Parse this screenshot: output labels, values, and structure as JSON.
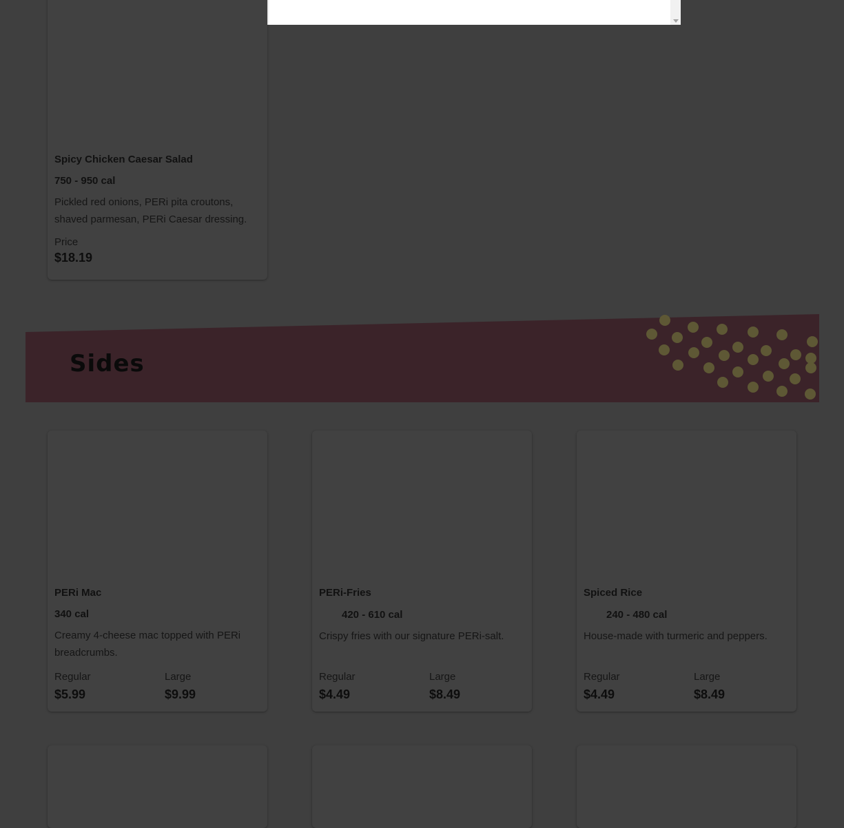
{
  "featured": {
    "name": "Spicy Chicken Caesar Salad",
    "calories": "750 - 950 cal",
    "description": "Pickled red onions, PERi pita croutons, shaved parmesan, PERi Caesar dressing.",
    "price_label": "Price",
    "price": "$18.19"
  },
  "section": {
    "title": "Sides",
    "banner_color": "#3b2329",
    "dot_color": "#5e5835"
  },
  "sides": [
    {
      "name": "PERi Mac",
      "calories": "340 cal",
      "description": "Creamy 4-cheese mac topped with PERi breadcrumbs.",
      "prices": [
        {
          "label": "Regular",
          "value": "$5.99"
        },
        {
          "label": "Large",
          "value": "$9.99"
        }
      ]
    },
    {
      "name": "PERi-Fries",
      "calories": "420 - 610 cal",
      "description": "Crispy fries with our signature PERi-salt.",
      "prices": [
        {
          "label": "Regular",
          "value": "$4.49"
        },
        {
          "label": "Large",
          "value": "$8.49"
        }
      ]
    },
    {
      "name": "Spiced Rice",
      "calories": "240 - 480 cal",
      "description": "House-made with turmeric and peppers.",
      "prices": [
        {
          "label": "Regular",
          "value": "$4.49"
        },
        {
          "label": "Large",
          "value": "$8.49"
        }
      ]
    }
  ]
}
